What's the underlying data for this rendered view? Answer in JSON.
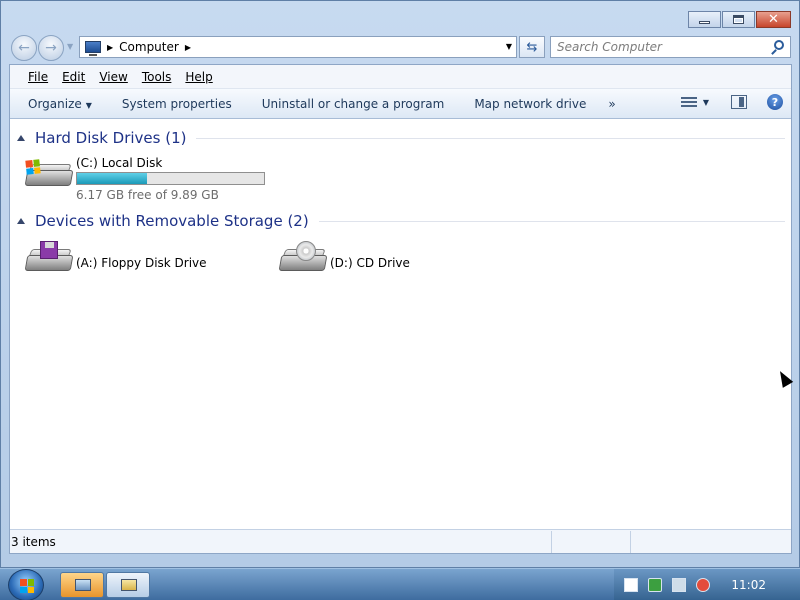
{
  "address": {
    "crumbs": [
      "Computer"
    ]
  },
  "search": {
    "placeholder": "Search Computer"
  },
  "menu": {
    "items": [
      "File",
      "Edit",
      "View",
      "Tools",
      "Help"
    ]
  },
  "commands": {
    "organize": "Organize",
    "system_properties": "System properties",
    "uninstall": "Uninstall or change a program",
    "map_drive": "Map network drive",
    "more": "»"
  },
  "groups": [
    {
      "title": "Hard Disk Drives (1)",
      "items": [
        {
          "name": "(C:) Local Disk",
          "free_text": "6.17 GB free of 9.89 GB",
          "used_fraction": 0.376,
          "icon": "hard-disk-icon"
        }
      ]
    },
    {
      "title": "Devices with Removable Storage (2)",
      "items": [
        {
          "name": "(A:) Floppy Disk Drive",
          "icon": "floppy-drive-icon"
        },
        {
          "name": "(D:) CD Drive",
          "icon": "cd-drive-icon"
        }
      ]
    }
  ],
  "status": {
    "item_count": "3 items"
  },
  "taskbar": {
    "clock": "11:02"
  },
  "colors": {
    "accent": "#1e3287",
    "bar_fill": "#26a6c4"
  }
}
